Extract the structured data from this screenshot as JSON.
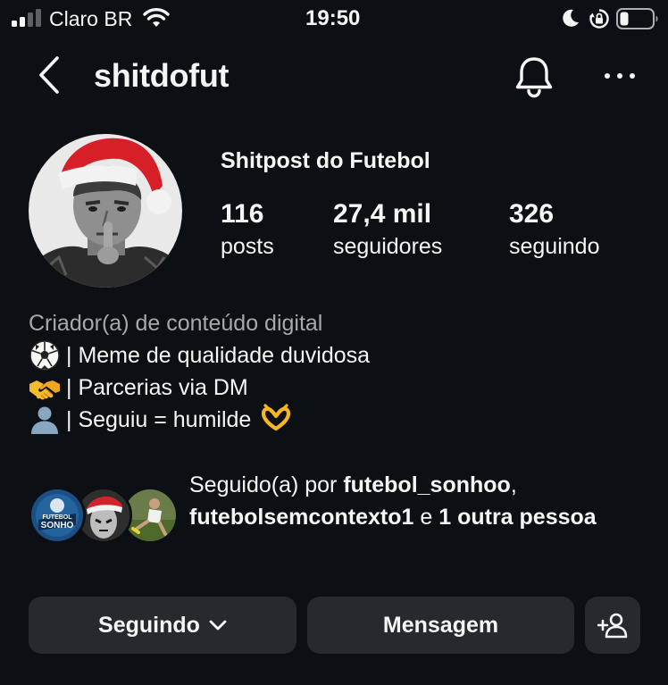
{
  "status_bar": {
    "carrier": "Claro BR",
    "time": "19:50",
    "icons": [
      "signal-icon",
      "wifi-icon",
      "moon-icon",
      "rotation-lock-icon",
      "battery-icon"
    ]
  },
  "header": {
    "username": "shitdofut",
    "icons": [
      "back-arrow-icon",
      "bell-icon",
      "more-icon"
    ]
  },
  "profile": {
    "display_name": "Shitpost do Futebol",
    "stats": [
      {
        "value": "116",
        "label": "posts"
      },
      {
        "value": "27,4 mil",
        "label": "seguidores"
      },
      {
        "value": "326",
        "label": "seguindo"
      }
    ]
  },
  "bio": {
    "category": "Criador(a) de conteúdo digital",
    "lines": [
      {
        "emoji": "soccer-ball-icon",
        "text": "| Meme de qualidade duvidosa"
      },
      {
        "emoji": "handshake-icon",
        "text": "| Parcerias via DM"
      },
      {
        "emoji": "person-silhouette-icon",
        "text": "| Seguiu = humilde",
        "trailing_emoji": "heart-hands-icon"
      }
    ]
  },
  "followed_by": {
    "prefix": "Seguido(a) por ",
    "user1": "futebol_sonhoo",
    "comma": ",",
    "user2": "futebolsemcontexto1",
    "conjunction": " e ",
    "others": "1 outra pessoa",
    "avatar_badge_line1": "FUTEBOL",
    "avatar_badge_line2": "SONHO"
  },
  "actions": {
    "following_label": "Seguindo",
    "message_label": "Mensagem"
  },
  "colors": {
    "background": "#0c1014",
    "button": "#262a2f",
    "secondary_text": "#a8a8a8"
  }
}
